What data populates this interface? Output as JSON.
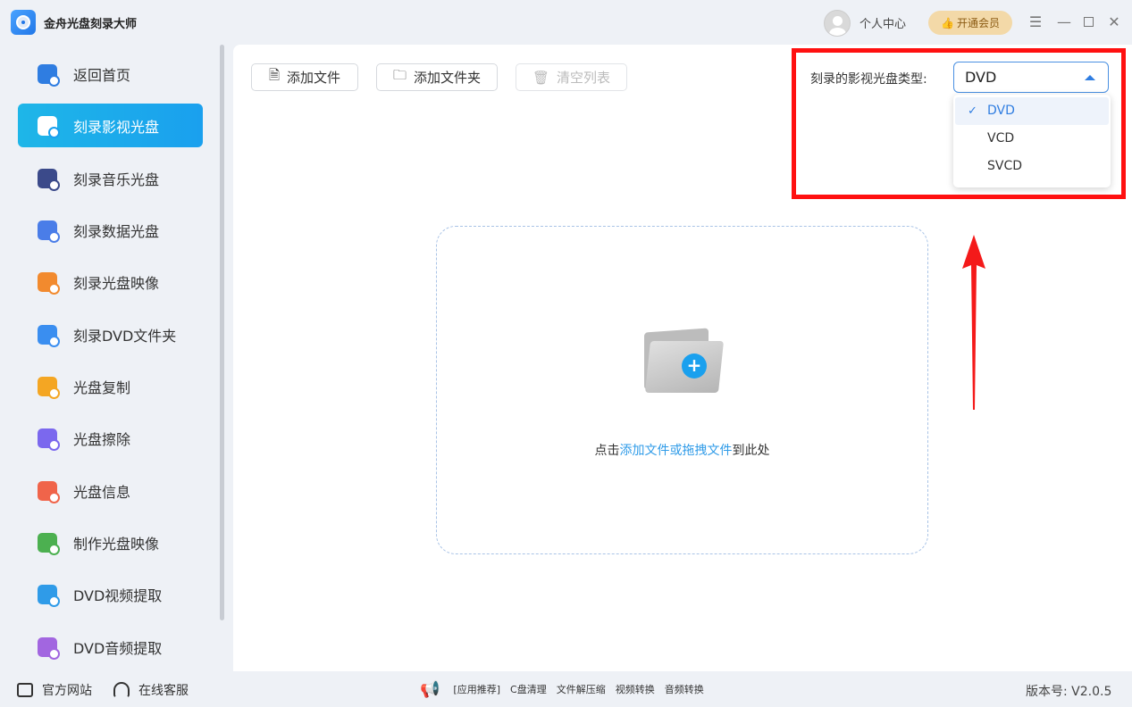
{
  "app": {
    "title": "金舟光盘刻录大师"
  },
  "header": {
    "user_center": "个人中心",
    "vip_label": "开通会员"
  },
  "sidebar": {
    "items": [
      {
        "label": "返回首页",
        "icon": "home-icon",
        "color": "#2f7de1"
      },
      {
        "label": "刻录影视光盘",
        "icon": "video-disc-icon",
        "color": "#1aa0ee",
        "active": true
      },
      {
        "label": "刻录音乐光盘",
        "icon": "music-disc-icon",
        "color": "#3b4a8a"
      },
      {
        "label": "刻录数据光盘",
        "icon": "data-disc-icon",
        "color": "#4a7de8"
      },
      {
        "label": "刻录光盘映像",
        "icon": "image-disc-icon",
        "color": "#f28a2e"
      },
      {
        "label": "刻录DVD文件夹",
        "icon": "dvd-folder-icon",
        "color": "#3a8ef0"
      },
      {
        "label": "光盘复制",
        "icon": "copy-disc-icon",
        "color": "#f4a623"
      },
      {
        "label": "光盘擦除",
        "icon": "erase-disc-icon",
        "color": "#7b68ee"
      },
      {
        "label": "光盘信息",
        "icon": "info-disc-icon",
        "color": "#f0644a"
      },
      {
        "label": "制作光盘映像",
        "icon": "make-image-icon",
        "color": "#4cb050"
      },
      {
        "label": "DVD视频提取",
        "icon": "video-extract-icon",
        "color": "#2f9be8"
      },
      {
        "label": "DVD音频提取",
        "icon": "audio-extract-icon",
        "color": "#a266e0"
      }
    ]
  },
  "toolbar": {
    "add_file": "添加文件",
    "add_folder": "添加文件夹",
    "clear_list": "清空列表"
  },
  "disc_type": {
    "label": "刻录的影视光盘类型:",
    "selected": "DVD",
    "options": [
      "DVD",
      "VCD",
      "SVCD"
    ]
  },
  "dropzone": {
    "prefix": "点击",
    "link": "添加文件或拖拽文件",
    "suffix": "到此处"
  },
  "footer": {
    "official_site": "官方网站",
    "support": "在线客服",
    "promo": [
      "[应用推荐]",
      "C盘清理",
      "文件解压缩",
      "视频转换",
      "音频转换"
    ],
    "version": "版本号: V2.0.5"
  }
}
